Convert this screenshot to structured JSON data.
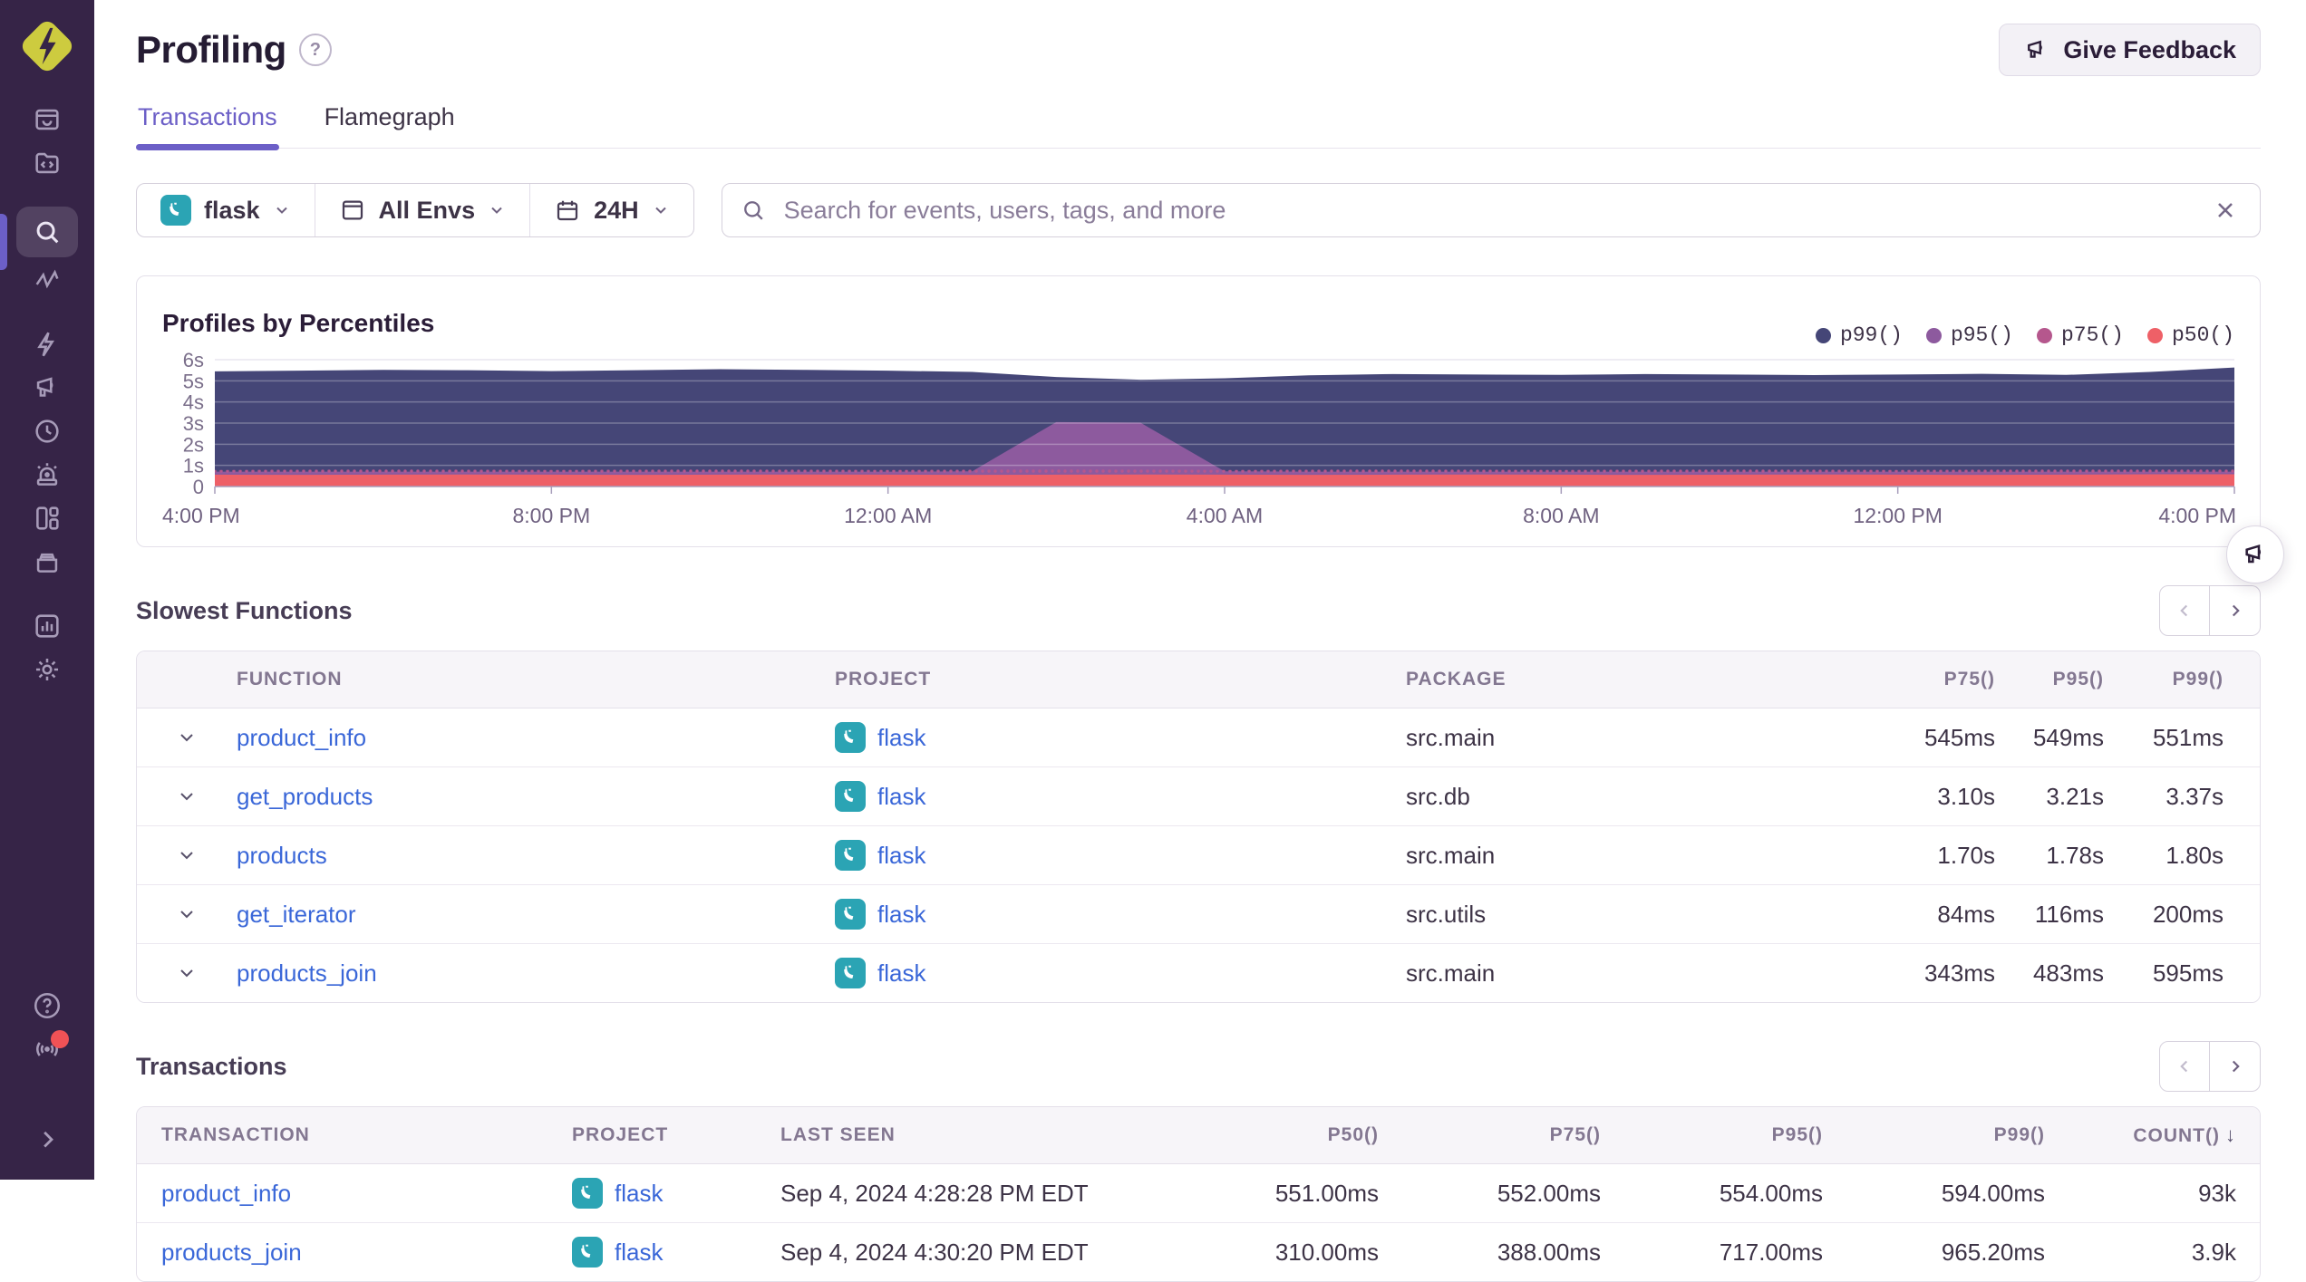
{
  "header": {
    "title": "Profiling",
    "give_feedback": "Give Feedback"
  },
  "tabs": [
    {
      "label": "Transactions",
      "active": true
    },
    {
      "label": "Flamegraph",
      "active": false
    }
  ],
  "filters": {
    "project": "flask",
    "env": "All Envs",
    "period": "24H",
    "search_placeholder": "Search for events, users, tags, and more"
  },
  "chart_data": {
    "type": "area",
    "title": "Profiles by Percentiles",
    "x_axis": "time (24H window)",
    "x": [
      0,
      1,
      2,
      3,
      4,
      5,
      6,
      7,
      8,
      9,
      10,
      11,
      12,
      13,
      14,
      15,
      16,
      17,
      18,
      19,
      20,
      21,
      22,
      23,
      24
    ],
    "xticks": [
      "4:00 PM",
      "8:00 PM",
      "12:00 AM",
      "4:00 AM",
      "8:00 AM",
      "12:00 PM",
      "4:00 PM"
    ],
    "xtick_positions": [
      0,
      4,
      8,
      12,
      16,
      20,
      24
    ],
    "yticks": [
      "6s",
      "5s",
      "4s",
      "3s",
      "2s",
      "1s",
      "0"
    ],
    "ytick_values": [
      6,
      5,
      4,
      3,
      2,
      1,
      0
    ],
    "ylim": [
      0,
      6
    ],
    "unit": "seconds",
    "grid": "horizontal",
    "legend_position": "top-right",
    "series": [
      {
        "name": "p99()",
        "color": "#454677",
        "values": [
          5.45,
          5.48,
          5.52,
          5.5,
          5.46,
          5.5,
          5.55,
          5.52,
          5.48,
          5.42,
          5.18,
          5.05,
          5.12,
          5.26,
          5.32,
          5.3,
          5.28,
          5.32,
          5.3,
          5.27,
          5.3,
          5.33,
          5.28,
          5.42,
          5.63
        ]
      },
      {
        "name": "p95()",
        "color": "#8D5A9E",
        "values": [
          0.7,
          0.7,
          0.7,
          0.7,
          0.7,
          0.7,
          0.7,
          0.7,
          0.7,
          0.72,
          3.05,
          3.02,
          0.72,
          0.7,
          0.7,
          0.7,
          0.7,
          0.7,
          0.7,
          0.7,
          0.7,
          0.7,
          0.7,
          0.7,
          0.7
        ]
      },
      {
        "name": "p75()",
        "color": "#B5578D",
        "dotted": true,
        "values": [
          0.78,
          0.8,
          0.82,
          0.8,
          0.78,
          0.8,
          0.82,
          0.8,
          0.78,
          0.8,
          0.82,
          0.8,
          0.78,
          0.8,
          0.82,
          0.8,
          0.78,
          0.8,
          0.82,
          0.8,
          0.78,
          0.8,
          0.82,
          0.86,
          0.88
        ]
      },
      {
        "name": "p50()",
        "color": "#EE6067",
        "values": [
          0.56,
          0.55,
          0.56,
          0.57,
          0.56,
          0.55,
          0.56,
          0.57,
          0.56,
          0.55,
          0.56,
          0.57,
          0.56,
          0.55,
          0.56,
          0.57,
          0.56,
          0.55,
          0.56,
          0.57,
          0.56,
          0.55,
          0.56,
          0.58,
          0.58
        ]
      }
    ]
  },
  "slowest_functions": {
    "title": "Slowest Functions",
    "columns": [
      "FUNCTION",
      "PROJECT",
      "PACKAGE",
      "P75()",
      "P95()",
      "P99()"
    ],
    "rows": [
      {
        "function": "product_info",
        "project": "flask",
        "package": "src.main",
        "p75": "545ms",
        "p95": "549ms",
        "p99": "551ms"
      },
      {
        "function": "get_products",
        "project": "flask",
        "package": "src.db",
        "p75": "3.10s",
        "p95": "3.21s",
        "p99": "3.37s"
      },
      {
        "function": "products",
        "project": "flask",
        "package": "src.main",
        "p75": "1.70s",
        "p95": "1.78s",
        "p99": "1.80s"
      },
      {
        "function": "get_iterator",
        "project": "flask",
        "package": "src.utils",
        "p75": "84ms",
        "p95": "116ms",
        "p99": "200ms"
      },
      {
        "function": "products_join",
        "project": "flask",
        "package": "src.main",
        "p75": "343ms",
        "p95": "483ms",
        "p99": "595ms"
      }
    ]
  },
  "transactions": {
    "title": "Transactions",
    "columns": [
      "TRANSACTION",
      "PROJECT",
      "LAST SEEN",
      "P50()",
      "P75()",
      "P95()",
      "P99()",
      "COUNT()"
    ],
    "sort_arrow": "↓",
    "rows": [
      {
        "transaction": "product_info",
        "project": "flask",
        "last_seen": "Sep 4, 2024 4:28:28 PM EDT",
        "p50": "551.00ms",
        "p75": "552.00ms",
        "p95": "554.00ms",
        "p99": "594.00ms",
        "count": "93k"
      },
      {
        "transaction": "products_join",
        "project": "flask",
        "last_seen": "Sep 4, 2024 4:30:20 PM EDT",
        "p50": "310.00ms",
        "p75": "388.00ms",
        "p95": "717.00ms",
        "p99": "965.20ms",
        "count": "3.9k"
      }
    ]
  },
  "sidebar": {
    "icons": [
      "sentry-logo",
      "inbox-icon",
      "code-folder-icon",
      "search-icon",
      "activity-icon",
      "lightning-icon",
      "megaphone-icon",
      "clock-history-icon",
      "siren-icon",
      "dashboard-grid-icon",
      "archive-box-icon",
      "bar-chart-icon",
      "gear-icon",
      "help-icon",
      "broadcast-icon",
      "chevron-right-icon"
    ],
    "active_icon": "search-icon",
    "notification_dot_color": "#f05256"
  },
  "colors": {
    "accent": "#6C5FC7",
    "link": "#3a67d8",
    "project_badge": "#2BA4B4",
    "sidebar_bg": "#362447"
  }
}
